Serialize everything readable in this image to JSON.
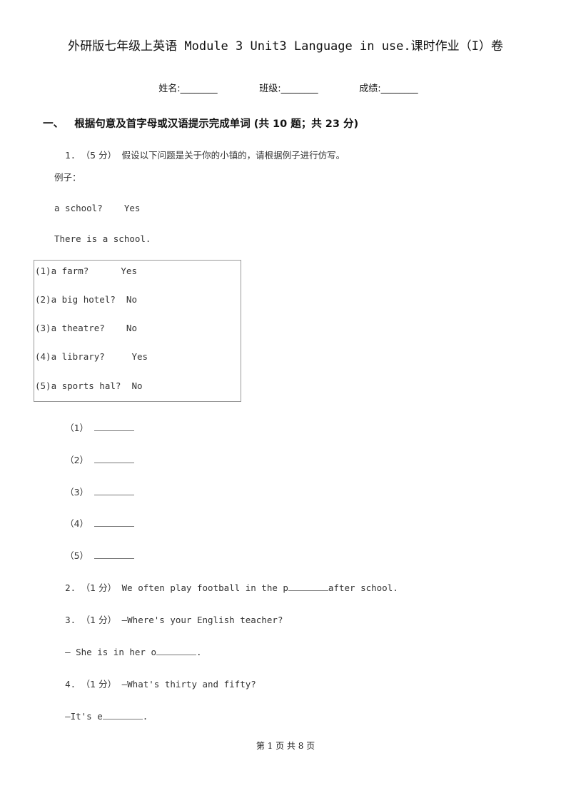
{
  "document": {
    "title": "外研版七年级上英语 Module 3 Unit3 Language in use.课时作业（I）卷",
    "info_fields": [
      {
        "label": "姓名:",
        "blank": "________"
      },
      {
        "label": "班级:",
        "blank": "________"
      },
      {
        "label": "成绩:",
        "blank": "________"
      }
    ],
    "section": {
      "number": "一、",
      "heading": "根据句意及首字母或汉语提示完成单词 (共 10 题；共 23 分)"
    },
    "questions": {
      "q1": {
        "number": "1.",
        "score": "（5 分）",
        "prompt": "假设以下问题是关于你的小镇的，请根据例子进行仿写。",
        "example_label": "例子：",
        "example_question": "a school?    Yes",
        "example_answer": "There is a school.",
        "table_rows": [
          "(1)a farm?      Yes",
          "(2)a big hotel?  No",
          "(3)a theatre?    No",
          "(4)a library?     Yes",
          "(5)a sports hal?  No"
        ],
        "answers": [
          {
            "label": "（1）",
            "blank": ""
          },
          {
            "label": "（2）",
            "blank": ""
          },
          {
            "label": "（3）",
            "blank": ""
          },
          {
            "label": "（4）",
            "blank": ""
          },
          {
            "label": "（5）",
            "blank": ""
          }
        ]
      },
      "q2": {
        "number": "2.",
        "score": "（1 分）",
        "before": "We often play football in the p",
        "after": "after school."
      },
      "q3": {
        "number": "3.",
        "score": "（1 分）",
        "prompt": "—Where's your English teacher?",
        "answer_before": "— She is in her o",
        "answer_after": "."
      },
      "q4": {
        "number": "4.",
        "score": "（1 分）",
        "prompt": "—What's thirty and fifty?",
        "answer_before": "—It's e",
        "answer_after": "."
      }
    },
    "footer": "第 1 页 共 8 页"
  }
}
